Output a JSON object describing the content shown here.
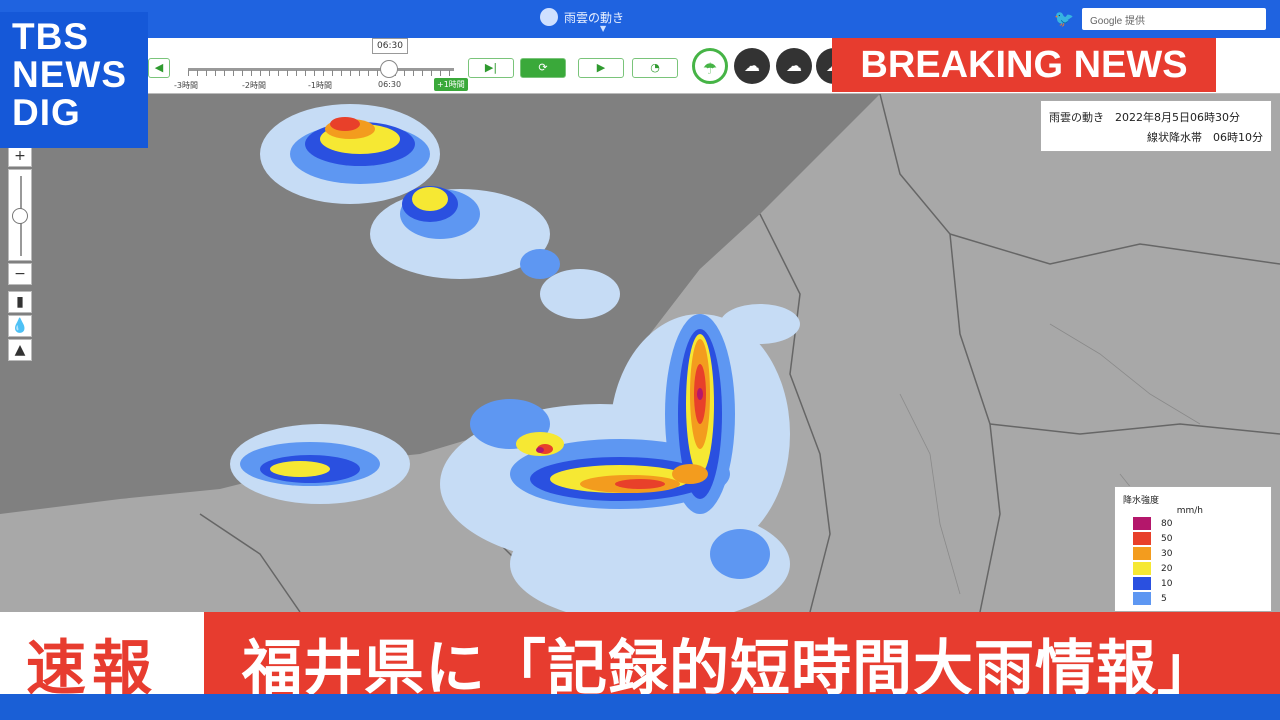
{
  "logo": {
    "line1": "TBS",
    "line2": "NEWS",
    "line3": "DIG"
  },
  "topbar": {
    "title": "雨雲の動き",
    "search_text": "Google 提供"
  },
  "controls": {
    "time_box": "06:30",
    "prev_button": "◀",
    "end_button": "▶|",
    "refresh_button": "⟳",
    "play_button": "▶",
    "speed_button": "◔",
    "tick_labels": [
      "-3時間",
      "-2時間",
      "-1時間",
      "06:30"
    ],
    "plus1h": "+1時間"
  },
  "breaking_news": "BREAKING NEWS",
  "zoom": {
    "plus": "+",
    "minus": "−"
  },
  "infobox": {
    "line1": "雨雲の動き　2022年8月5日06時30分",
    "line2": "線状降水帯　06時10分"
  },
  "legend": {
    "title": "降水強度",
    "unit": "mm/h",
    "items": [
      {
        "value": "80",
        "color": "#b4176b"
      },
      {
        "value": "50",
        "color": "#e8402a"
      },
      {
        "value": "30",
        "color": "#f39c1e"
      },
      {
        "value": "20",
        "color": "#f6e833"
      },
      {
        "value": "10",
        "color": "#2a50e0"
      },
      {
        "value": "5",
        "color": "#5e97f2"
      }
    ]
  },
  "caption": {
    "label": "速報",
    "headline": "福井県に「記録的短時間大雨情報」"
  }
}
